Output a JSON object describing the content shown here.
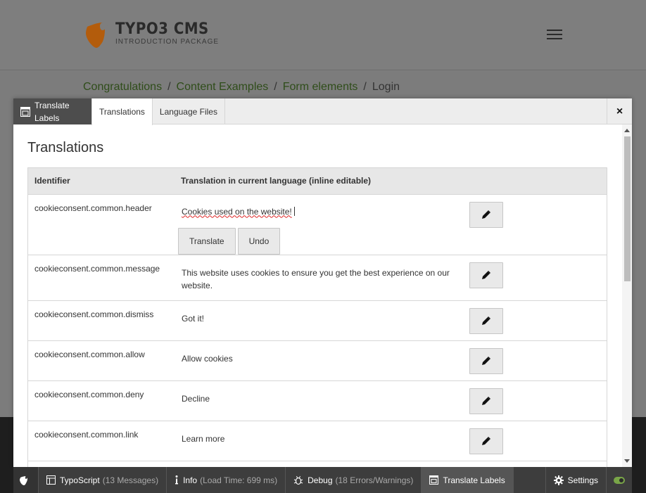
{
  "site": {
    "logo_title": "TYPO3 CMS",
    "logo_subtitle": "INTRODUCTION PACKAGE",
    "breadcrumb": [
      "Congratulations",
      "Content Examples",
      "Form elements",
      "Login"
    ],
    "breadcrumb_separator": "/"
  },
  "modal": {
    "brand_label": "Translate Labels",
    "tabs": [
      {
        "label": "Translations",
        "active": true
      },
      {
        "label": "Language Files",
        "active": false
      }
    ],
    "close_label": "×",
    "section_title": "Translations",
    "table": {
      "columns": [
        "Identifier",
        "Translation in current language (inline editable)"
      ],
      "rows": [
        {
          "identifier": "cookieconsent.common.header",
          "value": "Cookies used on the website!",
          "editing": true
        },
        {
          "identifier": "cookieconsent.common.message",
          "value": "This website uses cookies to ensure you get the best experience on our website."
        },
        {
          "identifier": "cookieconsent.common.dismiss",
          "value": "Got it!"
        },
        {
          "identifier": "cookieconsent.common.allow",
          "value": "Allow cookies"
        },
        {
          "identifier": "cookieconsent.common.deny",
          "value": "Decline"
        },
        {
          "identifier": "cookieconsent.common.link",
          "value": "Learn more"
        }
      ]
    },
    "inline_actions": {
      "translate_label": "Translate",
      "undo_label": "Undo"
    }
  },
  "debugbar": {
    "typoscript_label": "TypoScript",
    "typoscript_meta": "(13 Messages)",
    "info_label": "Info",
    "info_meta": "(Load Time: 699 ms)",
    "debug_label": "Debug",
    "debug_meta": "(18 Errors/Warnings)",
    "translate_label": "Translate Labels",
    "settings_label": "Settings"
  },
  "colors": {
    "breadcrumb_link": "#2f4d1a",
    "logo_orange": "#c0650d",
    "toggle_on": "#79a548"
  }
}
